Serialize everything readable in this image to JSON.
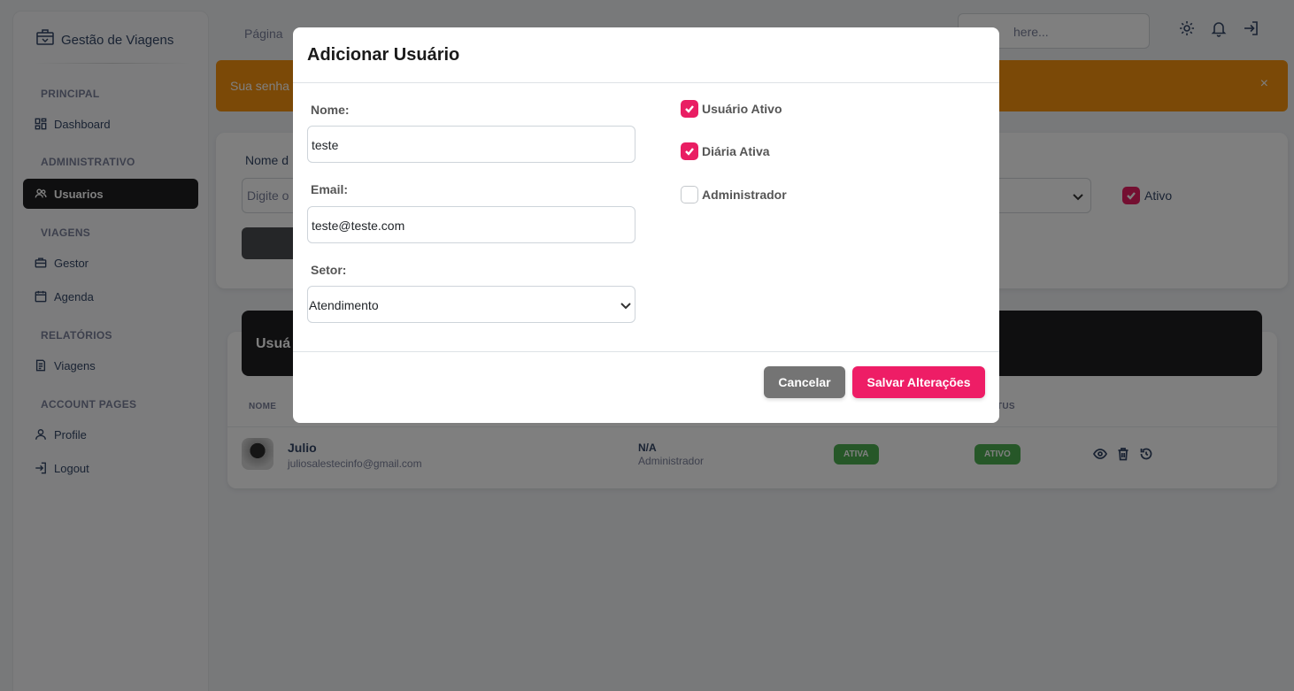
{
  "brand": {
    "title": "Gestão de Viagens",
    "icon": "luggage-icon"
  },
  "sidebar": {
    "sections": [
      {
        "label": "PRINCIPAL"
      },
      {
        "label": "ADMINISTRATIVO"
      },
      {
        "label": "VIAGENS"
      },
      {
        "label": "RELATÓRIOS"
      },
      {
        "label": "ACCOUNT PAGES"
      }
    ],
    "items": [
      {
        "label": "Dashboard",
        "icon": "dashboard-icon"
      },
      {
        "label": "Usuarios",
        "icon": "users-icon",
        "active": true
      },
      {
        "label": "Gestor",
        "icon": "briefcase-icon"
      },
      {
        "label": "Agenda",
        "icon": "calendar-icon"
      },
      {
        "label": "Viagens",
        "icon": "document-icon"
      },
      {
        "label": "Profile",
        "icon": "user-icon"
      },
      {
        "label": "Logout",
        "icon": "logout-icon"
      }
    ]
  },
  "navbar": {
    "breadcrumb": "Página",
    "search_placeholder": "here...",
    "icons": [
      "gear-icon",
      "bell-icon",
      "sign-in-icon"
    ]
  },
  "alert": {
    "text": "Sua senha",
    "close": "×",
    "color": "#f7930e"
  },
  "filter": {
    "name_label": "Nome d",
    "name_placeholder": "Digite o",
    "active_label": "Ativo"
  },
  "users": {
    "header": "Usuá",
    "columns": {
      "name": "NOME",
      "status": "TUS"
    },
    "rows": [
      {
        "name": "Julio",
        "email": "juliosalestecinfo@gmail.com",
        "sector": "N/A",
        "role": "Administrador",
        "daily_badge": "ATIVA",
        "status_badge": "ATIVO"
      }
    ]
  },
  "modal": {
    "title": "Adicionar Usuário",
    "fields": {
      "nome_label": "Nome:",
      "nome_value": "teste",
      "email_label": "Email:",
      "email_value": "teste@teste.com",
      "setor_label": "Setor:",
      "setor_value": "Atendimento"
    },
    "checkboxes": [
      {
        "label": "Usuário Ativo",
        "checked": true
      },
      {
        "label": "Diária Ativa",
        "checked": true
      },
      {
        "label": "Administrador",
        "checked": false
      }
    ],
    "cancel_label": "Cancelar",
    "save_label": "Salvar Alterações"
  },
  "colors": {
    "accent": "#e91e63",
    "sidebar_active": "#1e1e21",
    "badge_success": "#4caf50",
    "cancel_button": "#747474"
  }
}
